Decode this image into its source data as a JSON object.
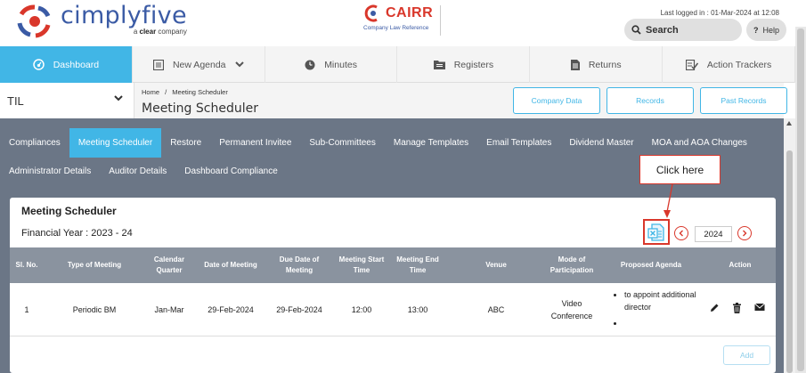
{
  "header": {
    "brand": "cimplyfive",
    "tagline_pre": "a ",
    "tagline_bold": "clear",
    "tagline_post": " company",
    "cairr_name": "CAIRR",
    "cairr_sub": "Company Law Reference",
    "last_logged": "Last logged in : 01-Mar-2024 at 12:08",
    "search_label": "Search",
    "help_label": "Help",
    "help_q": "?"
  },
  "nav": {
    "items": [
      {
        "label": "Dashboard",
        "icon": "dashboard-icon"
      },
      {
        "label": "New Agenda",
        "icon": "list-icon"
      },
      {
        "label": "Minutes",
        "icon": "clock-icon"
      },
      {
        "label": "Registers",
        "icon": "folder-icon"
      },
      {
        "label": "Returns",
        "icon": "document-icon"
      },
      {
        "label": "Action Trackers",
        "icon": "checklist-icon"
      }
    ],
    "active_color": "#41b6e6"
  },
  "company": {
    "name": "TIL"
  },
  "breadcrumb": {
    "home": "Home",
    "sep": "/",
    "current": "Meeting Scheduler"
  },
  "page_title": "Meeting Scheduler",
  "company_buttons": [
    "Company Data",
    "Records",
    "Past Records"
  ],
  "menu": {
    "row1": [
      "Compliances",
      "Meeting Scheduler",
      "Restore",
      "Permanent Invitee",
      "Sub-Committees",
      "Manage Templates",
      "Email Templates",
      "Dividend Master",
      "MOA and AOA Changes"
    ],
    "row2": [
      "Administrator Details",
      "Auditor Details",
      "Dashboard Compliance"
    ],
    "active": "Meeting Scheduler"
  },
  "card": {
    "title": "Meeting Scheduler",
    "financial_year": "Financial Year : 2023 - 24",
    "year": "2024"
  },
  "table": {
    "headers": [
      "Sl. No.",
      "Type of Meeting",
      "Calendar\nQuarter",
      "Date of Meeting",
      "Due Date of\nMeeting",
      "Meeting Start\nTime",
      "Meeting End\nTime",
      "Venue",
      "Mode of\nParticipation",
      "Proposed Agenda",
      "Action"
    ],
    "rows": [
      {
        "sl": "1",
        "type": "Periodic BM",
        "quarter": "Jan-Mar",
        "date": "29-Feb-2024",
        "due": "29-Feb-2024",
        "start": "12:00",
        "end": "13:00",
        "venue": "ABC",
        "mode": "Video\nConference",
        "agenda": [
          "to appoint additional director",
          ""
        ]
      }
    ]
  },
  "add_button": "Add",
  "callout": "Click here",
  "colors": {
    "accent": "#41b6e6",
    "panel": "#6b7686",
    "table_header": "#8a939f",
    "highlight": "#d9372b"
  }
}
